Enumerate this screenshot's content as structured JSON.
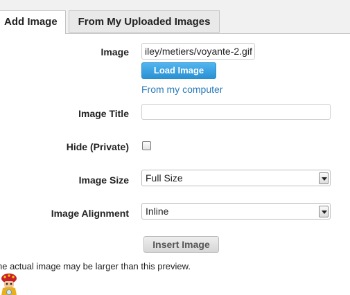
{
  "tabs": {
    "add_image": "Add Image",
    "uploaded_images": "From My Uploaded Images"
  },
  "form": {
    "image_label": "Image",
    "image_value": "iley/metiers/voyante-2.gif",
    "load_button": "Load Image",
    "from_computer_link": "From my computer",
    "title_label": "Image Title",
    "title_value": "",
    "hide_label": "Hide (Private)",
    "hide_checked": false,
    "size_label": "Image Size",
    "size_value": "Full Size",
    "alignment_label": "Image Alignment",
    "alignment_value": "Inline",
    "insert_button": "Insert Image"
  },
  "preview_note": "he actual image may be larger than this preview.",
  "colors": {
    "accent": "#2a91d4",
    "link": "#2a7ab8",
    "tab_bg": "#f1f1f1"
  },
  "icons": {
    "preview": "fortune-teller-image"
  }
}
